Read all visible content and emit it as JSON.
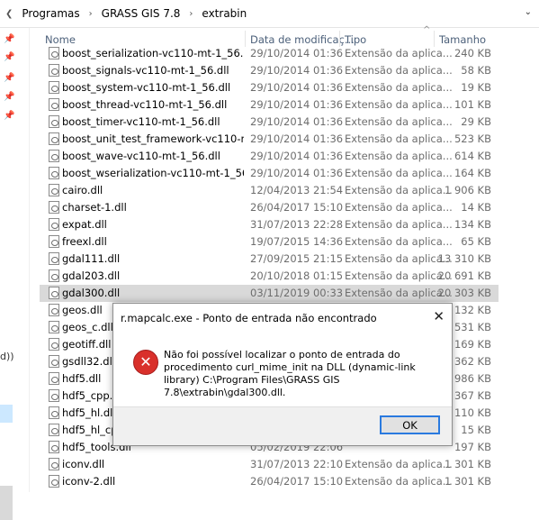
{
  "breadcrumb": [
    "Programas",
    "GRASS GIS 7.8",
    "extrabin"
  ],
  "headers": {
    "name": "Nome",
    "date": "Data de modificaç...",
    "type": "Tipo",
    "size": "Tamanho"
  },
  "nav": {
    "paren_text": "d))"
  },
  "files": [
    {
      "name": "boost_serialization-vc110-mt-1_56.dll",
      "date": "29/10/2014 01:36",
      "type": "Extensão da aplica...",
      "size": "240 KB"
    },
    {
      "name": "boost_signals-vc110-mt-1_56.dll",
      "date": "29/10/2014 01:36",
      "type": "Extensão da aplica...",
      "size": "58 KB"
    },
    {
      "name": "boost_system-vc110-mt-1_56.dll",
      "date": "29/10/2014 01:36",
      "type": "Extensão da aplica...",
      "size": "19 KB"
    },
    {
      "name": "boost_thread-vc110-mt-1_56.dll",
      "date": "29/10/2014 01:36",
      "type": "Extensão da aplica...",
      "size": "101 KB"
    },
    {
      "name": "boost_timer-vc110-mt-1_56.dll",
      "date": "29/10/2014 01:36",
      "type": "Extensão da aplica...",
      "size": "29 KB"
    },
    {
      "name": "boost_unit_test_framework-vc110-mt-1_5...",
      "date": "29/10/2014 01:36",
      "type": "Extensão da aplica...",
      "size": "523 KB"
    },
    {
      "name": "boost_wave-vc110-mt-1_56.dll",
      "date": "29/10/2014 01:36",
      "type": "Extensão da aplica...",
      "size": "614 KB"
    },
    {
      "name": "boost_wserialization-vc110-mt-1_56.dll",
      "date": "29/10/2014 01:36",
      "type": "Extensão da aplica...",
      "size": "164 KB"
    },
    {
      "name": "cairo.dll",
      "date": "12/04/2013 21:54",
      "type": "Extensão da aplica...",
      "size": "1 906 KB"
    },
    {
      "name": "charset-1.dll",
      "date": "26/04/2017 15:10",
      "type": "Extensão da aplica...",
      "size": "14 KB"
    },
    {
      "name": "expat.dll",
      "date": "31/07/2013 22:28",
      "type": "Extensão da aplica...",
      "size": "134 KB"
    },
    {
      "name": "freexl.dll",
      "date": "19/07/2015 14:36",
      "type": "Extensão da aplica...",
      "size": "65 KB"
    },
    {
      "name": "gdal111.dll",
      "date": "27/09/2015 21:15",
      "type": "Extensão da aplica...",
      "size": "13 310 KB"
    },
    {
      "name": "gdal203.dll",
      "date": "20/10/2018 01:15",
      "type": "Extensão da aplica...",
      "size": "20 691 KB"
    },
    {
      "name": "gdal300.dll",
      "date": "03/11/2019 00:33",
      "type": "Extensão da aplica...",
      "size": "20 303 KB"
    },
    {
      "name": "geos.dll",
      "date": "",
      "type": "",
      "size": "2 132 KB"
    },
    {
      "name": "geos_c.dll",
      "date": "",
      "type": "",
      "size": "531 KB"
    },
    {
      "name": "geotiff.dll",
      "date": "",
      "type": "",
      "size": "169 KB"
    },
    {
      "name": "gsdll32.dll",
      "date": "",
      "type": "",
      "size": "5 362 KB"
    },
    {
      "name": "hdf5.dll",
      "date": "",
      "type": "",
      "size": "2 986 KB"
    },
    {
      "name": "hdf5_cpp.dll",
      "date": "",
      "type": "",
      "size": "367 KB"
    },
    {
      "name": "hdf5_hl.dll",
      "date": "",
      "type": "",
      "size": "110 KB"
    },
    {
      "name": "hdf5_hl_cpp.dll",
      "date": "",
      "type": "",
      "size": "15 KB"
    },
    {
      "name": "hdf5_tools.dll",
      "date": "05/02/2019 22:06",
      "type": "",
      "size": "197 KB"
    },
    {
      "name": "iconv.dll",
      "date": "31/07/2013 22:10",
      "type": "Extensão da aplica...",
      "size": "1 301 KB"
    },
    {
      "name": "iconv-2.dll",
      "date": "26/04/2017 15:10",
      "type": "Extensão da aplica...",
      "size": "1 301 KB"
    }
  ],
  "selected_index": 14,
  "dialog": {
    "title": "r.mapcalc.exe - Ponto de entrada não encontrado",
    "message": "Não foi possível localizar o ponto de entrada do procedimento curl_mime_init na DLL (dynamic-link library) C:\\Program Files\\GRASS GIS 7.8\\extrabin\\gdal300.dll.",
    "ok_label": "OK",
    "close_glyph": "✕",
    "icon_glyph": "✕",
    "icon": "error-icon"
  },
  "colors": {
    "accent": "#2a7adf",
    "error": "#d9302b",
    "selected_row": "#d9d9d9"
  }
}
